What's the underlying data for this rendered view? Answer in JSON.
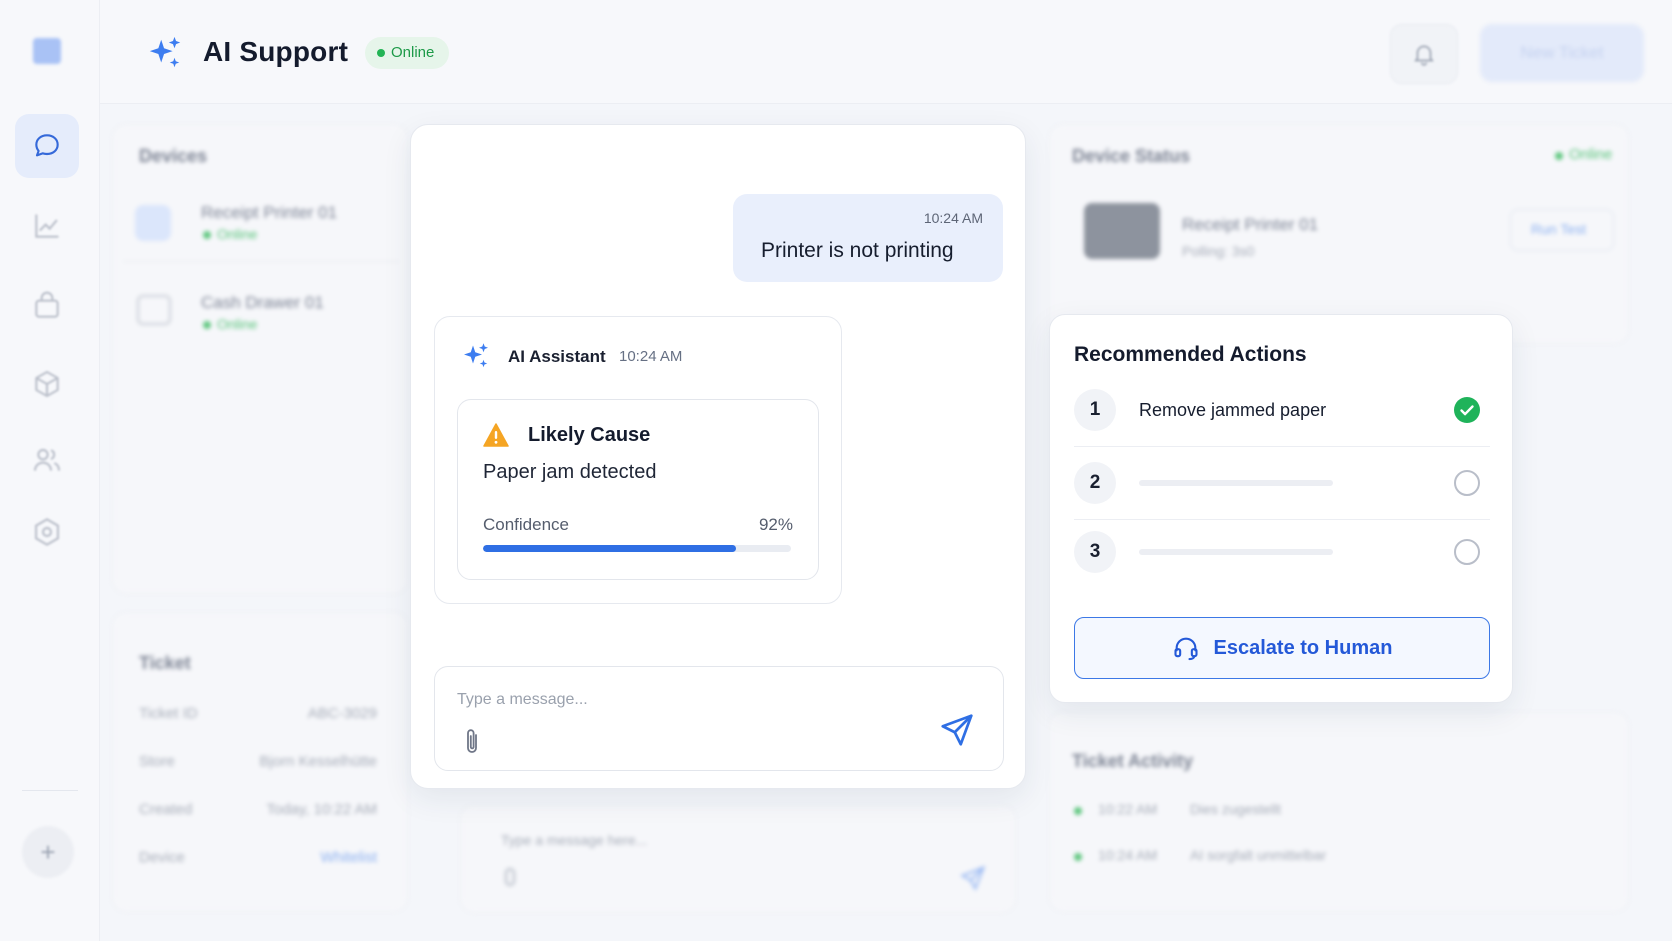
{
  "header": {
    "title": "AI Support",
    "status": "Online",
    "new_ticket_label": "New Ticket"
  },
  "sidebar": {
    "items": [
      {
        "icon": "chat-icon",
        "active": true
      },
      {
        "icon": "chart-icon",
        "active": false
      },
      {
        "icon": "bag-icon",
        "active": false
      },
      {
        "icon": "cube-icon",
        "active": false
      },
      {
        "icon": "users-icon",
        "active": false
      },
      {
        "icon": "gear-icon",
        "active": false
      }
    ]
  },
  "background": {
    "devices_title": "Devices",
    "devices": [
      {
        "name": "Receipt Printer 01",
        "status": "Online"
      },
      {
        "name": "Cash Drawer 01",
        "status": "Online"
      }
    ],
    "ticket_title": "Ticket",
    "ticket_rows": [
      {
        "label": "Ticket ID",
        "value": "ABC-3029"
      },
      {
        "label": "Store",
        "value": "Bjorn Kesselhütte"
      },
      {
        "label": "Created",
        "value": "Today, 10:22 AM"
      },
      {
        "label": "Device",
        "value": "Whitelist"
      }
    ],
    "device_status_title": "Device Status",
    "device_status_badge": "Online",
    "device_status_name": "Receipt Printer 01",
    "device_status_sub": "Polling: 3s0",
    "run_test_label": "Run Test",
    "activity_title": "Ticket Activity",
    "activity": [
      {
        "time": "10:22 AM",
        "text": "Dies zugestellt"
      },
      {
        "time": "10:24 AM",
        "text": "AI sorgfalt unmittelbar"
      }
    ],
    "ghost_input_placeholder": "Type a message here..."
  },
  "chat": {
    "user_message": {
      "time": "10:24 AM",
      "text": "Printer is not printing"
    },
    "ai_message": {
      "sender": "AI Assistant",
      "time": "10:24 AM",
      "cause_title": "Likely Cause",
      "cause_text": "Paper jam detected",
      "confidence_label": "Confidence",
      "confidence_value": "92%",
      "confidence_fraction": 0.82
    },
    "input_placeholder": "Type a message..."
  },
  "recommended": {
    "title": "Recommended Actions",
    "actions": [
      {
        "number": "1",
        "label": "Remove jammed paper",
        "done": true
      },
      {
        "number": "2",
        "label": "",
        "done": false
      },
      {
        "number": "3",
        "label": "",
        "done": false
      }
    ],
    "escalate_label": "Escalate to Human"
  },
  "colors": {
    "accent": "#2f6fe4",
    "online_green": "#22b455",
    "warning_orange": "#f5a524",
    "check_green": "#1fb35a"
  }
}
